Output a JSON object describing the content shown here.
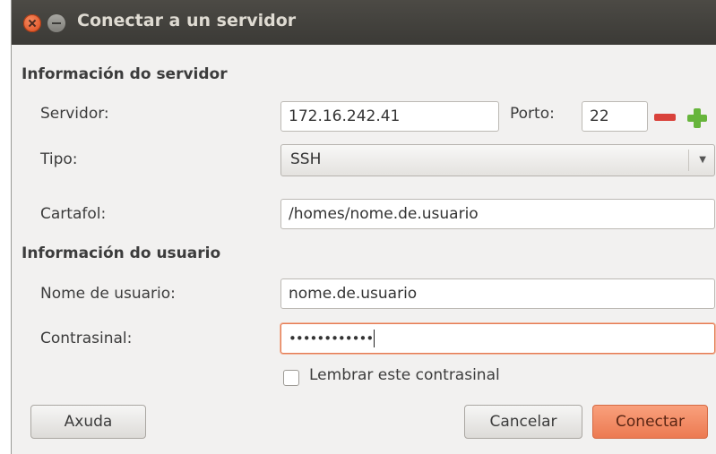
{
  "window": {
    "title": "Conectar a un servidor"
  },
  "server_section": {
    "heading": "Información do servidor",
    "server_label": "Servidor:",
    "server_value": "172.16.242.41",
    "port_label": "Porto:",
    "port_value": "22",
    "type_label": "Tipo:",
    "type_value": "SSH",
    "folder_label": "Cartafol:",
    "folder_value": "/homes/nome.de.usuario"
  },
  "user_section": {
    "heading": "Información do usuario",
    "username_label": "Nome de usuario:",
    "username_value": "nome.de.usuario",
    "password_label": "Contrasinal:",
    "password_value": "••••••••••••",
    "remember_label": "Lembrar este contrasinal"
  },
  "buttons": {
    "help": "Axuda",
    "cancel": "Cancelar",
    "connect": "Conectar"
  },
  "icons": {
    "close": "close-icon",
    "minimize": "minimize-icon",
    "decrement": "minus-icon",
    "increment": "plus-icon",
    "dropdown": "chevron-down-icon"
  },
  "colors": {
    "titlebar": "#3f3e3a",
    "accent": "#ec7a52",
    "minus": "#d9423b",
    "plus": "#67b53c"
  }
}
